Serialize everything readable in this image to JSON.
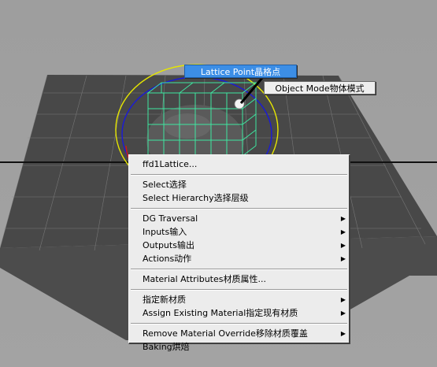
{
  "hotbox": {
    "lattice_point_label": "Lattice Point晶格点",
    "object_mode_label": "Object Mode物体模式"
  },
  "context_menu": {
    "lattice": "ffd1Lattice...",
    "select": "Select选择",
    "select_hierarchy": "Select Hierarchy选择层级",
    "dg_traversal": "DG Traversal",
    "inputs": "Inputs输入",
    "outputs": "Outputs输出",
    "actions": "Actions动作",
    "material_attributes": "Material Attributes材质属性...",
    "assign_new_material": "指定新材质",
    "assign_existing_material": "Assign Existing Material指定现有材质",
    "remove_material_override": "Remove Material Override移除材质覆盖",
    "baking": "Baking烘焙",
    "submenu_arrow": "▶"
  },
  "colors": {
    "viewport_bg": "#a0a0a0",
    "grid_plane": "#4a4a4a",
    "lattice": "#3ee6a0",
    "manip_yellow": "#e6e600",
    "manip_blue": "#1a1ad8",
    "manip_red": "#cc1a1a",
    "hotbox_selected": "#3c8ee6"
  },
  "icons": {
    "submenu": "chevron-right-icon"
  }
}
